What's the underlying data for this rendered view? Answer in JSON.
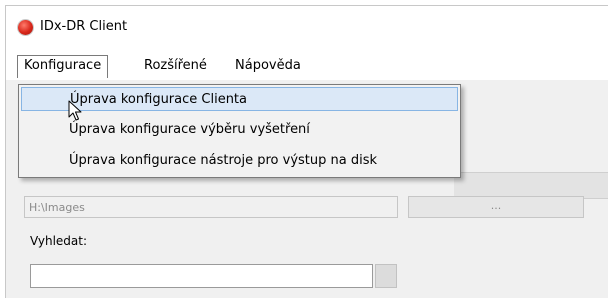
{
  "window": {
    "title": "IDx-DR Client"
  },
  "menubar": {
    "items": [
      {
        "label": "Konfigurace"
      },
      {
        "label": "Rozšířené"
      },
      {
        "label": "Nápověda"
      }
    ]
  },
  "dropdown": {
    "items": [
      {
        "label": "Úprava konfigurace Clienta"
      },
      {
        "label": "Úprava konfigurace výběru vyšetření"
      },
      {
        "label": "Úprava konfigurace nástroje pro výstup na disk"
      }
    ]
  },
  "form": {
    "path_value": "H:\\Images",
    "browse_label": "...",
    "search_label": "Vyhledat:",
    "search_value": ""
  },
  "icons": {
    "app": "idx-dr-app-icon",
    "cursor": "mouse-pointer-icon"
  },
  "colors": {
    "hover_fill": "#dbe8f7",
    "hover_border": "#87b5e4",
    "app_icon_red": "#d8261a"
  }
}
